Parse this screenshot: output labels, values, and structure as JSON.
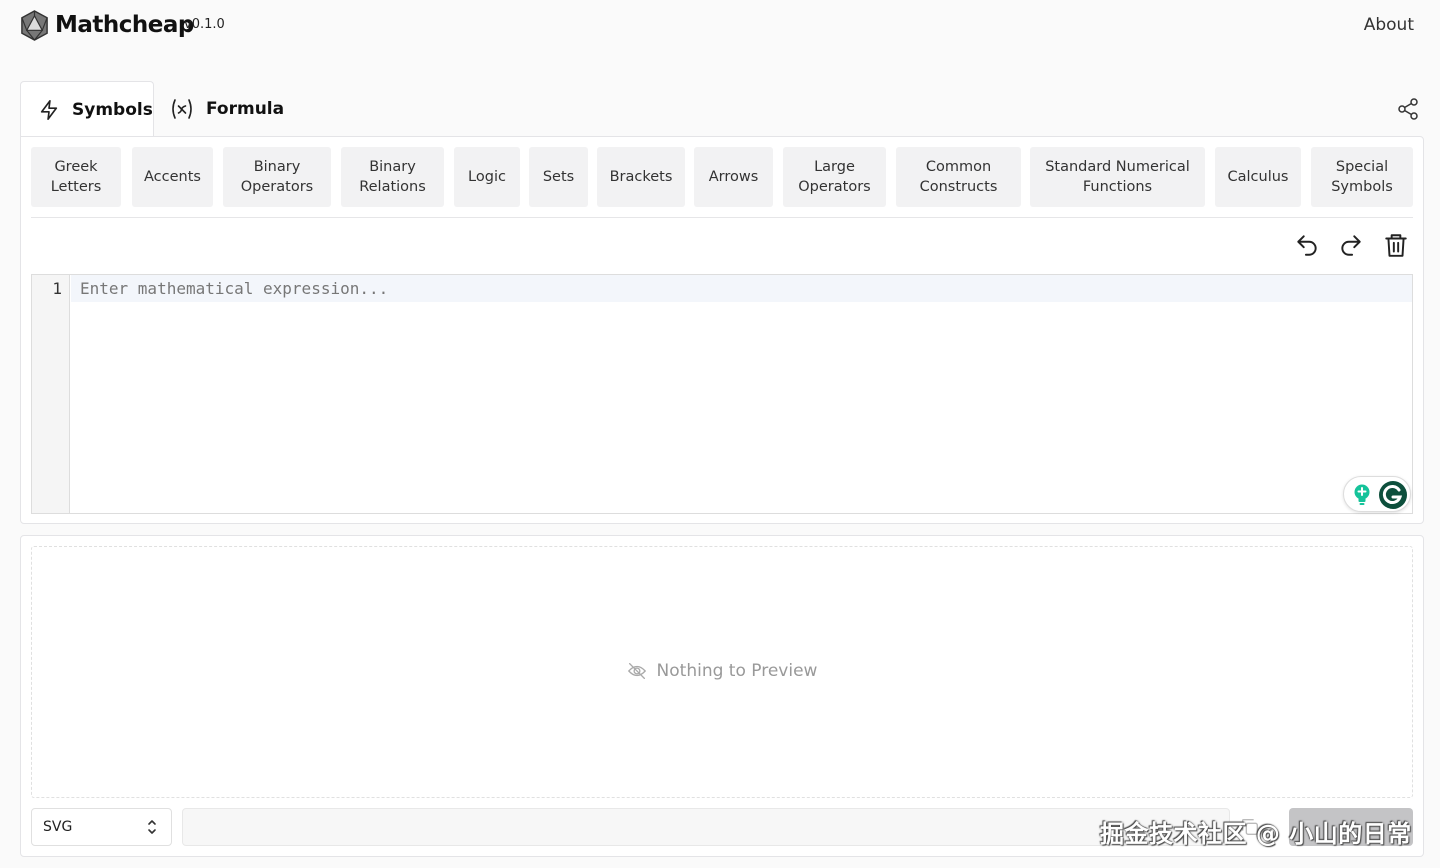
{
  "header": {
    "brand": "Mathcheap",
    "version": "v0.1.0",
    "about_label": "About"
  },
  "tabs": [
    {
      "label": "Symbols",
      "icon": "lightning-icon",
      "active": true
    },
    {
      "label": "Formula",
      "icon": "function-x-icon",
      "active": false
    }
  ],
  "categories": [
    "Greek Letters",
    "Accents",
    "Binary Operators",
    "Binary Relations",
    "Logic",
    "Sets",
    "Brackets",
    "Arrows",
    "Large Operators",
    "Common Constructs",
    "Standard Numerical Functions",
    "Calculus",
    "Special Symbols"
  ],
  "toolbar": {
    "undo_icon": "undo-icon",
    "redo_icon": "redo-icon",
    "clear_icon": "trash-icon"
  },
  "editor": {
    "line_number": "1",
    "placeholder": "Enter mathematical expression..."
  },
  "preview": {
    "empty_message": "Nothing to Preview",
    "empty_icon": "eye-off-icon"
  },
  "export": {
    "format_selected": "SVG",
    "output_value": ""
  },
  "watermark": "掘金技术社区 @ 小山的日常",
  "colors": {
    "grammarly_green": "#15c39a",
    "grammarly_dark": "#0d4f3c",
    "download_disabled": "#c4c4c6"
  }
}
